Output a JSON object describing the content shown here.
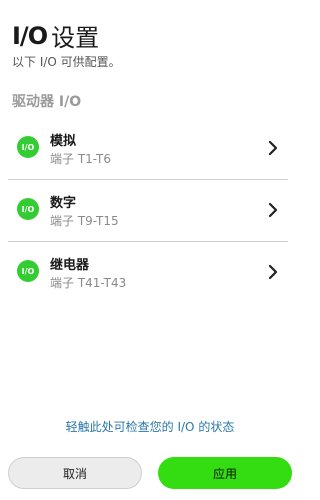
{
  "header": {
    "title_io": "I/O",
    "title_text": "设置",
    "subtitle": "以下 I/O 可供配置。"
  },
  "section": {
    "label": "驱动器 I/O"
  },
  "items": [
    {
      "badge": "I/O",
      "title": "模拟",
      "subtitle": "端子 T1-T6",
      "icon": "chevron-right-icon"
    },
    {
      "badge": "I/O",
      "title": "数字",
      "subtitle": "端子 T9-T15",
      "icon": "chevron-right-icon"
    },
    {
      "badge": "I/O",
      "title": "继电器",
      "subtitle": "端子 T41-T43",
      "icon": "chevron-right-icon"
    }
  ],
  "status_link": "轻触此处可检查您的 I/O 的状态",
  "buttons": {
    "cancel": "取消",
    "apply": "应用"
  },
  "colors": {
    "accent_green": "#33dd11",
    "badge_green": "#33cc33",
    "link_blue": "#2a78a8"
  }
}
